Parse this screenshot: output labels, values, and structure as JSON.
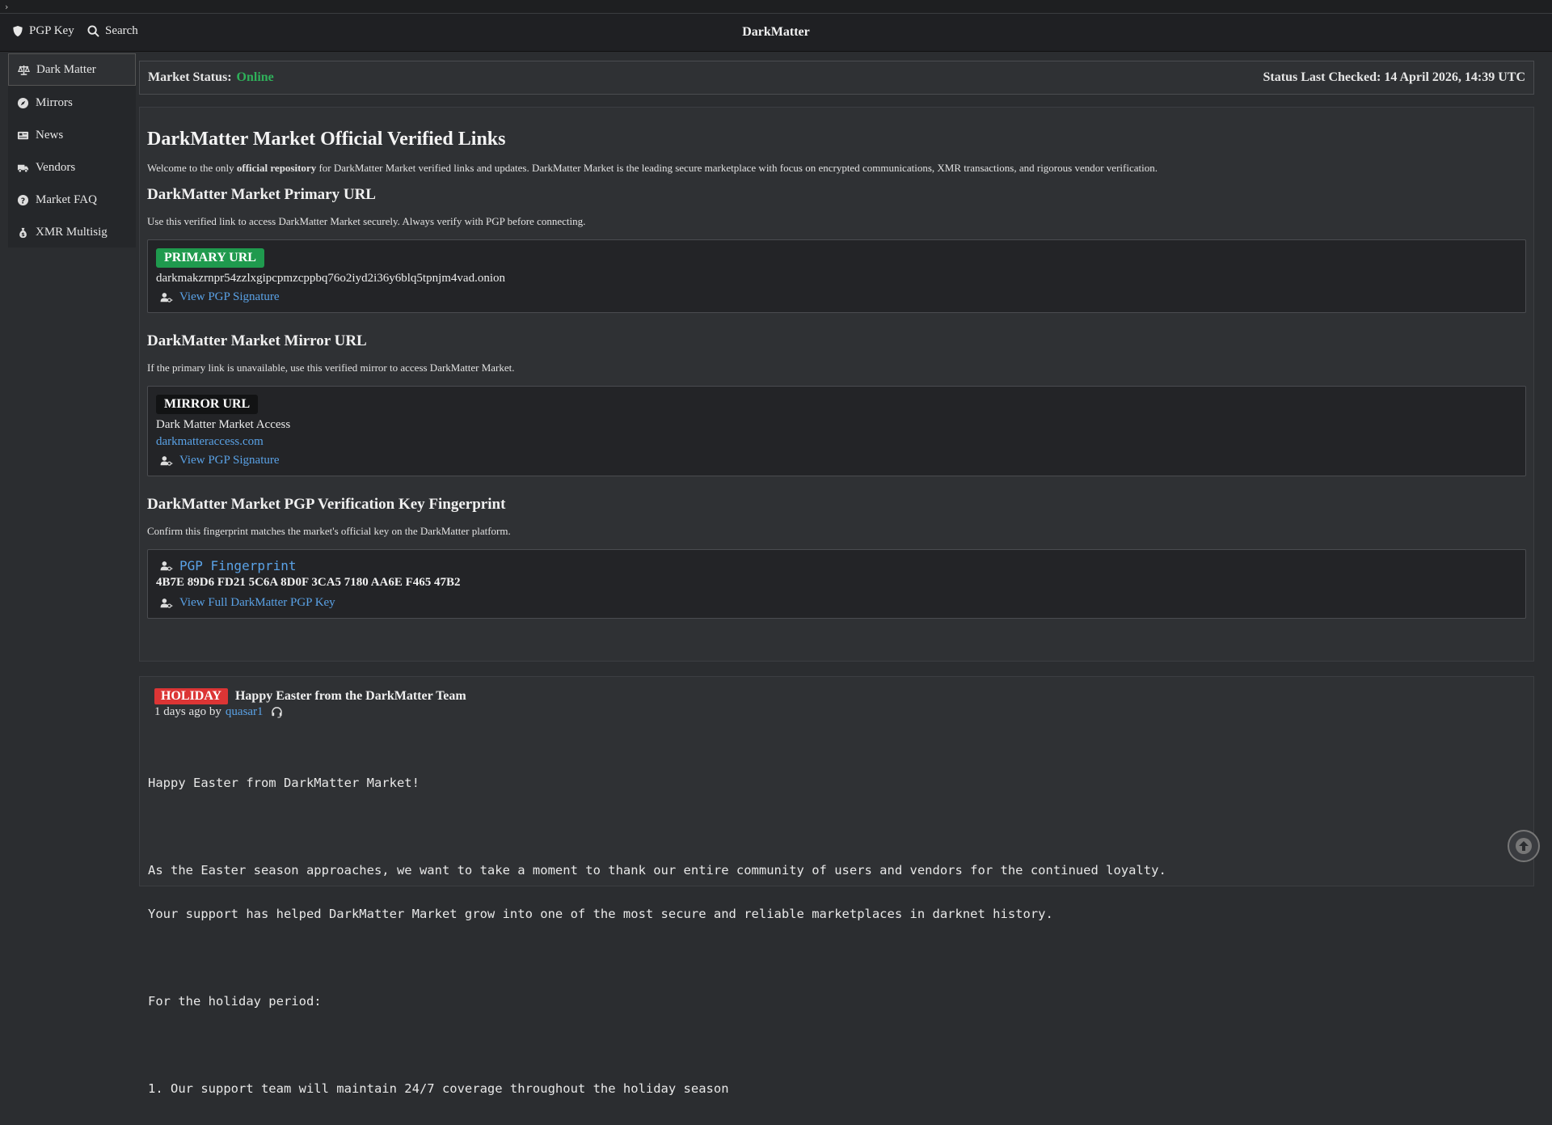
{
  "navbar": {
    "pgp_key_label": "PGP Key",
    "search_label": "Search",
    "brand": "DarkMatter"
  },
  "sidebar": {
    "items": [
      {
        "label": "Dark Matter",
        "icon": "scale-icon",
        "active": true
      },
      {
        "label": "Mirrors",
        "icon": "compass-icon"
      },
      {
        "label": "News",
        "icon": "newspaper-icon"
      },
      {
        "label": "Vendors",
        "icon": "truck-icon"
      },
      {
        "label": "Market FAQ",
        "icon": "question-icon"
      },
      {
        "label": "XMR Multisig",
        "icon": "money-bag-icon"
      }
    ]
  },
  "status": {
    "label": "Market Status:",
    "value": "Online",
    "checked": "Status Last Checked: 14 April 2026, 14:39 UTC"
  },
  "main": {
    "title": "DarkMatter Market Official Verified Links",
    "intro_prefix": "Welcome to the only ",
    "intro_bold": "official repository",
    "intro_suffix": " for DarkMatter Market verified links and updates. DarkMatter Market is the leading secure marketplace with focus on encrypted communications, XMR transactions, and rigorous vendor verification.",
    "primary": {
      "heading": "DarkMatter Market Primary URL",
      "desc": "Use this verified link to access DarkMatter Market securely. Always verify with PGP before connecting.",
      "badge": "PRIMARY URL",
      "url": "darkmakzrnpr54zzlxgipcpmzcppbq76o2iyd2i36y6blq5tpnjm4vad.onion",
      "sig_link": "View PGP Signature"
    },
    "mirror": {
      "heading": "DarkMatter Market Mirror URL",
      "desc": "If the primary link is unavailable, use this verified mirror to access DarkMatter Market.",
      "badge": "MIRROR URL",
      "name": "Dark Matter Market Access",
      "url": "darkmatteraccess.com",
      "sig_link": "View PGP Signature"
    },
    "pgp": {
      "heading": "DarkMatter Market PGP Verification Key Fingerprint",
      "desc": "Confirm this fingerprint matches the market's official key on the DarkMatter platform.",
      "fp_title": "PGP Fingerprint",
      "fingerprint": "4B7E 89D6 FD21 5C6A 8D0F 3CA5 7180 AA6E F465 47B2",
      "full_key_link": "View Full DarkMatter PGP Key"
    }
  },
  "news": {
    "badge": "HOLIDAY",
    "title": "Happy Easter from the DarkMatter Team",
    "meta_prefix": "1 days ago by",
    "author": "quasar1",
    "lines": [
      "Happy Easter from DarkMatter Market!",
      "",
      "As the Easter season approaches, we want to take a moment to thank our entire community of users and vendors for the continued loyalty.",
      "Your support has helped DarkMatter Market grow into one of the most secure and reliable marketplaces in darknet history.",
      "",
      "For the holiday period:",
      "",
      "1. Our support team will maintain 24/7 coverage throughout the holiday season"
    ]
  }
}
